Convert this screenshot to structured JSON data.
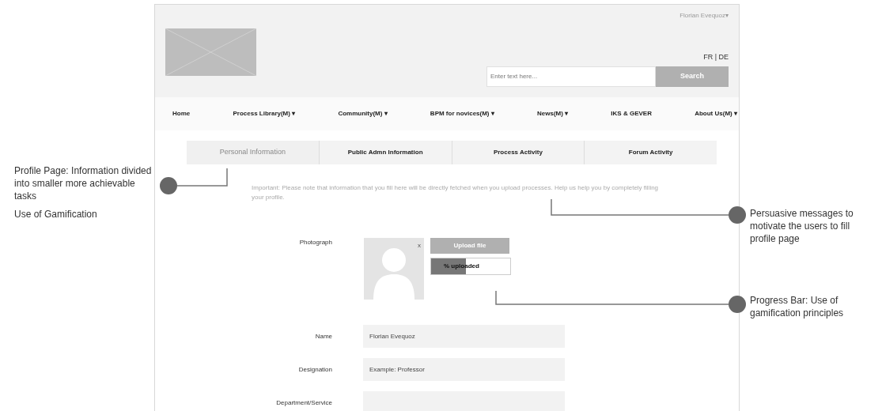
{
  "header": {
    "user_menu": "Florian Evequoz▾",
    "languages": "FR | DE",
    "search": {
      "placeholder": "Enter text here...",
      "button": "Search"
    }
  },
  "nav": [
    "Home",
    "Process Library(M) ▾",
    "Community(M) ▾",
    "BPM for novices(M) ▾",
    "News(M) ▾",
    "IKS & GEVER",
    "About Us(M) ▾"
  ],
  "tabs": [
    {
      "label": "Personal Information",
      "selected": true
    },
    {
      "label": "Public Admn Information",
      "selected": false
    },
    {
      "label": "Process Activity",
      "selected": false
    },
    {
      "label": "Forum Activity",
      "selected": false
    }
  ],
  "notice": "Important: Please note that information that you fill here will be directly fetched when you upload processes. Help us help you by completely filling your profile.",
  "photo": {
    "label": "Photograph",
    "remove": "x",
    "upload_button": "Upload file",
    "progress": {
      "label": "% uploaded",
      "level": 0.44
    }
  },
  "fields": [
    {
      "label": "Name",
      "value": "Florian Evequoz"
    },
    {
      "label": "Designation",
      "value": "Example: Professor"
    },
    {
      "label": "Department/Service"
    }
  ],
  "left_notes": [
    "Profile Page: Information divided into smaller more achievable tasks",
    "Use of Gamification"
  ],
  "right_notes": [
    "Persuasive messages to motivate the users to fill profile page",
    "Progress Bar: Use of gamification principles"
  ]
}
